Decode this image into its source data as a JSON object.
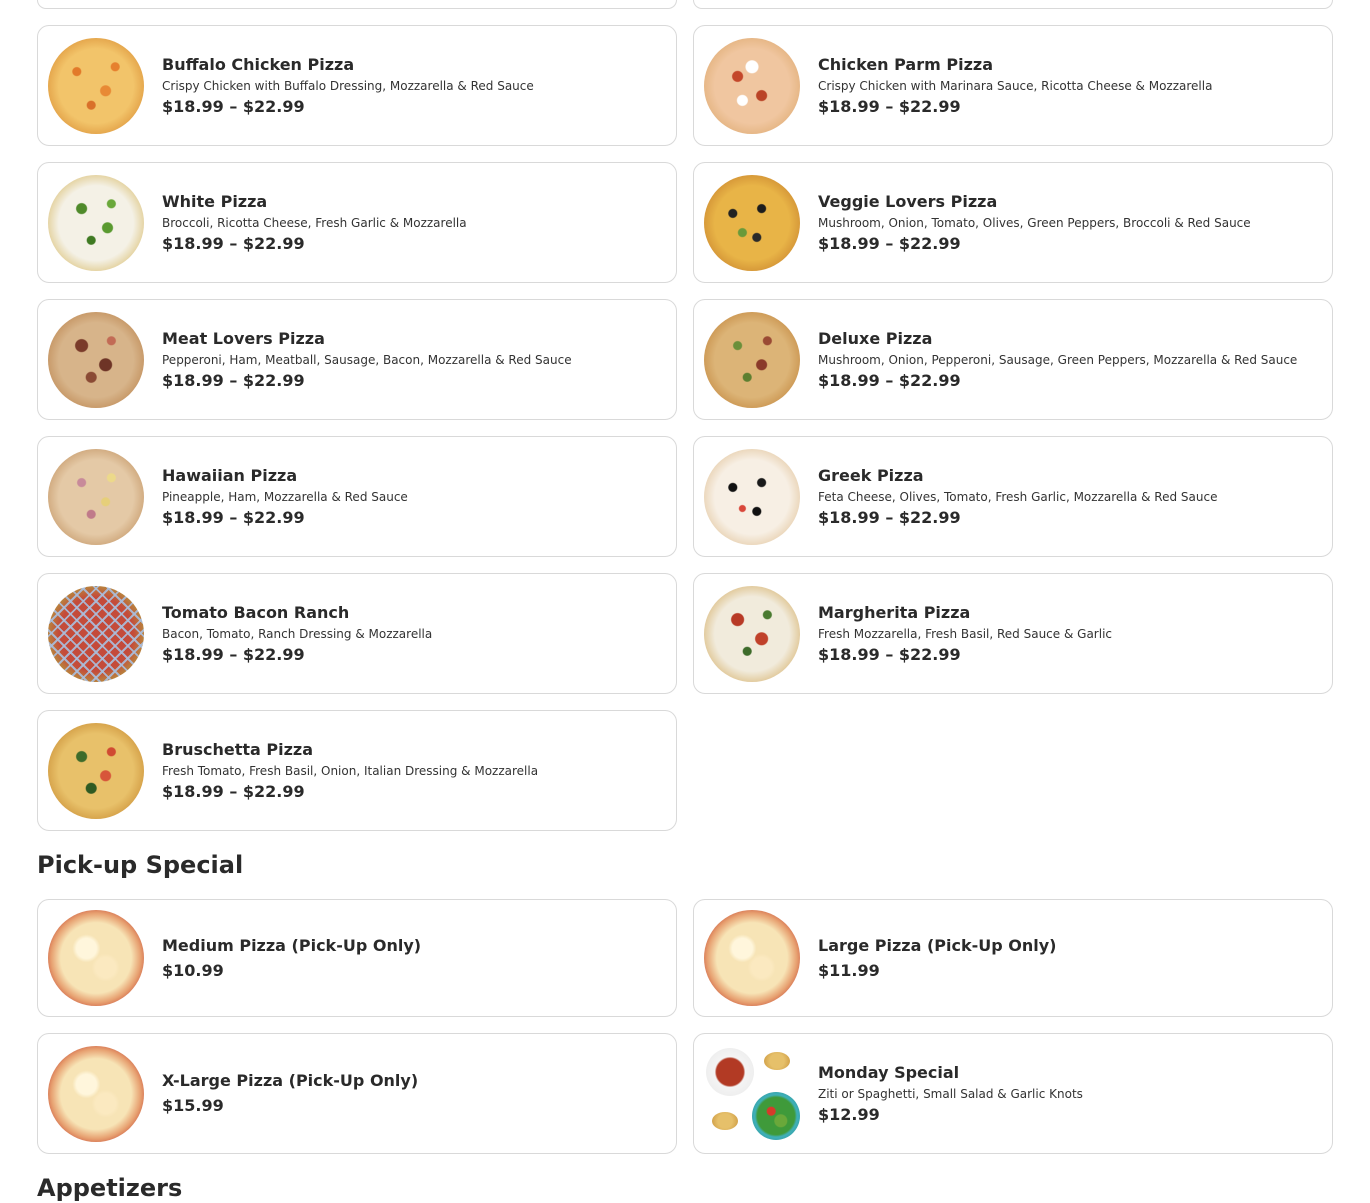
{
  "pizza_items": [
    {
      "name": "Buffalo Chicken Pizza",
      "desc": "Crispy Chicken with Buffalo Dressing, Mozzarella & Red Sauce",
      "price": "$18.99 – $22.99",
      "image_icon": "buffalo-chicken-pizza-image"
    },
    {
      "name": "Chicken Parm Pizza",
      "desc": "Crispy Chicken with Marinara Sauce, Ricotta Cheese & Mozzarella",
      "price": "$18.99 – $22.99",
      "image_icon": "chicken-parm-pizza-image"
    },
    {
      "name": "White Pizza",
      "desc": "Broccoli, Ricotta Cheese, Fresh Garlic & Mozzarella",
      "price": "$18.99 – $22.99",
      "image_icon": "white-pizza-image"
    },
    {
      "name": "Veggie Lovers Pizza",
      "desc": "Mushroom, Onion, Tomato, Olives, Green Peppers, Broccoli & Red Sauce",
      "price": "$18.99 – $22.99",
      "image_icon": "veggie-lovers-pizza-image"
    },
    {
      "name": "Meat Lovers Pizza",
      "desc": "Pepperoni, Ham, Meatball, Sausage, Bacon, Mozzarella & Red Sauce",
      "price": "$18.99 – $22.99",
      "image_icon": "meat-lovers-pizza-image"
    },
    {
      "name": "Deluxe Pizza",
      "desc": "Mushroom, Onion, Pepperoni, Sausage, Green Peppers, Mozzarella & Red Sauce",
      "price": "$18.99 – $22.99",
      "image_icon": "deluxe-pizza-image"
    },
    {
      "name": "Hawaiian Pizza",
      "desc": "Pineapple, Ham, Mozzarella & Red Sauce",
      "price": "$18.99 – $22.99",
      "image_icon": "hawaiian-pizza-image"
    },
    {
      "name": "Greek Pizza",
      "desc": "Feta Cheese, Olives, Tomato, Fresh Garlic, Mozzarella & Red Sauce",
      "price": "$18.99 – $22.99",
      "image_icon": "greek-pizza-image"
    },
    {
      "name": "Tomato Bacon Ranch",
      "desc": "Bacon, Tomato, Ranch Dressing & Mozzarella",
      "price": "$18.99 – $22.99",
      "image_icon": "tomato-bacon-ranch-pizza-image"
    },
    {
      "name": "Margherita Pizza",
      "desc": "Fresh Mozzarella, Fresh Basil, Red Sauce & Garlic",
      "price": "$18.99 – $22.99",
      "image_icon": "margherita-pizza-image"
    },
    {
      "name": "Bruschetta Pizza",
      "desc": "Fresh Tomato, Fresh Basil, Onion, Italian Dressing & Mozzarella",
      "price": "$18.99 – $22.99",
      "image_icon": "bruschetta-pizza-image"
    }
  ],
  "pickup_special": {
    "title": "Pick-up Special",
    "items": [
      {
        "name": "Medium Pizza (Pick-Up Only)",
        "price": "$10.99",
        "image_icon": "cheese-pizza-image"
      },
      {
        "name": "Large Pizza (Pick-Up Only)",
        "price": "$11.99",
        "image_icon": "cheese-pizza-image"
      },
      {
        "name": "X-Large Pizza (Pick-Up Only)",
        "price": "$15.99",
        "image_icon": "cheese-pizza-image"
      },
      {
        "name": "Monday Special",
        "desc": "Ziti or Spaghetti, Small Salad & Garlic Knots",
        "price": "$12.99",
        "image_icon": "pasta-salad-knots-image"
      }
    ]
  },
  "appetizers": {
    "title": "Appetizers"
  },
  "colors": {
    "card_border": "#d9d9d9",
    "text": "#2a2a2a",
    "background": "#ffffff"
  }
}
